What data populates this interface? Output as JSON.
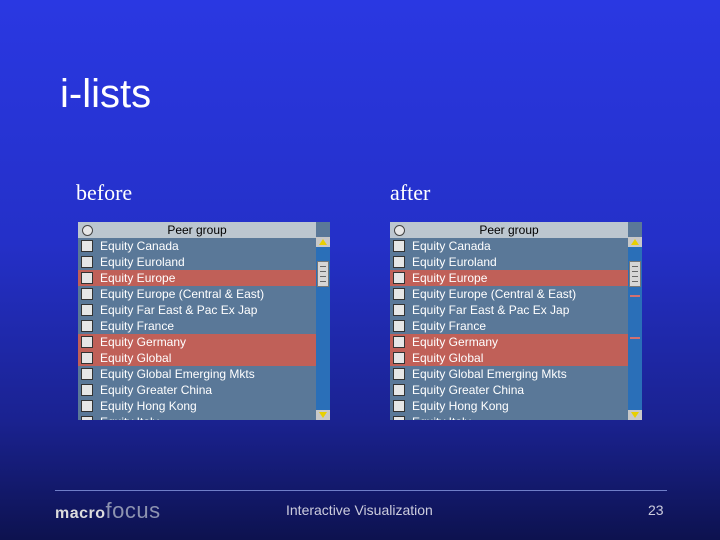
{
  "slide": {
    "title": "i-lists",
    "caption_before": "before",
    "caption_after": "after"
  },
  "list": {
    "header": "Peer group",
    "items": [
      {
        "label": "Equity Canada",
        "selected": false
      },
      {
        "label": "Equity Euroland",
        "selected": false
      },
      {
        "label": "Equity Europe",
        "selected": true
      },
      {
        "label": "Equity Europe (Central & East)",
        "selected": false
      },
      {
        "label": "Equity Far East & Pac Ex Jap",
        "selected": false
      },
      {
        "label": "Equity France",
        "selected": false
      },
      {
        "label": "Equity Germany",
        "selected": true
      },
      {
        "label": "Equity Global",
        "selected": true
      },
      {
        "label": "Equity Global Emerging Mkts",
        "selected": false
      },
      {
        "label": "Equity Greater China",
        "selected": false
      },
      {
        "label": "Equity Hong Kong",
        "selected": false
      },
      {
        "label": "Equity Italy",
        "selected": false
      }
    ]
  },
  "footer": {
    "logo": "macrofocus",
    "center_text": "Interactive Visualization",
    "page_number": "23"
  },
  "colors": {
    "selection": "#c06058",
    "row": "#5a7898",
    "scrollbar": "#2a6fb8"
  },
  "icons": [
    "checkbox-icon",
    "radio-icon",
    "arrow-up-icon",
    "arrow-down-icon"
  ]
}
